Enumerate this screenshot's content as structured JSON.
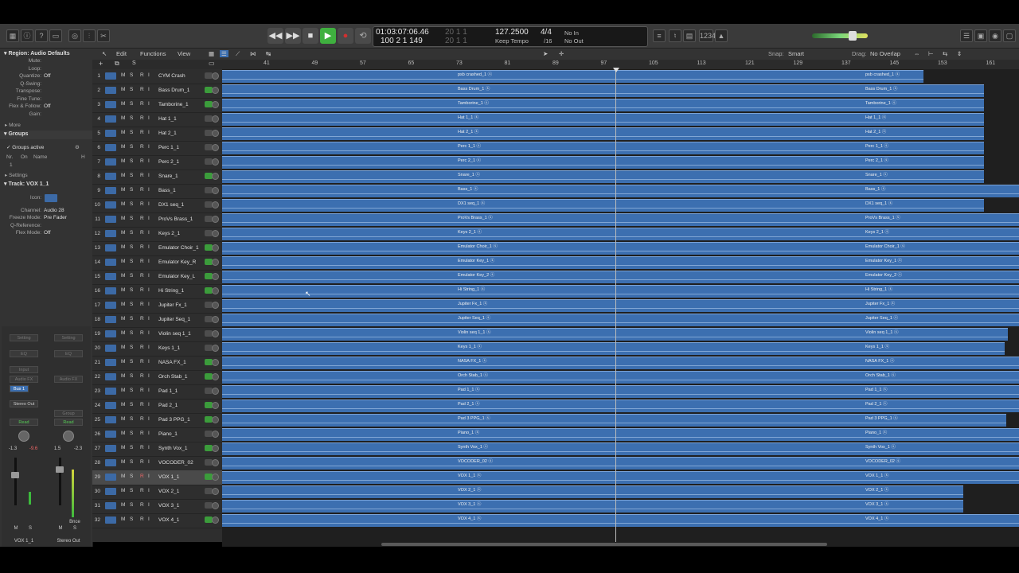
{
  "toolbar": {
    "lcd": {
      "time": "01:03:07:06.46",
      "bars": "100  2  1  149",
      "time_dim": "20  1  1",
      "time_dim2": "20  1  1",
      "tempo": "127.2500",
      "tempo_mode": "Keep Tempo",
      "sig_top": "4/4",
      "sig_bottom": "/16",
      "in": "No In",
      "out": "No Out"
    },
    "counter": "1234"
  },
  "menubar": {
    "edit": "Edit",
    "functions": "Functions",
    "view": "View",
    "snap_label": "Snap:",
    "snap_value": "Smart",
    "drag_label": "Drag:",
    "drag_value": "No Overlap"
  },
  "inspector": {
    "region_header": "Region:",
    "region_name": "Audio Defaults",
    "rows": [
      {
        "label": "Mute:",
        "value": ""
      },
      {
        "label": "Loop:",
        "value": ""
      },
      {
        "label": "Quantize:",
        "value": "Off"
      },
      {
        "label": "Q-Swing:",
        "value": ""
      },
      {
        "label": "Transpose:",
        "value": ""
      },
      {
        "label": "Fine Tune:",
        "value": ""
      },
      {
        "label": "Flex & Follow:",
        "value": "Off"
      },
      {
        "label": "Gain:",
        "value": ""
      }
    ],
    "more": "More",
    "groups_header": "Groups",
    "groups_active": "Groups active",
    "groups_cols": [
      "Nr.",
      "On",
      "Name",
      "H"
    ],
    "group_nr": "1",
    "settings": "Settings",
    "track_header": "Track:",
    "track_name": "VOX 1_1",
    "track_rows": [
      {
        "label": "Icon:",
        "value": ""
      },
      {
        "label": "Channel:",
        "value": "Audio 28"
      },
      {
        "label": "Freeze Mode:",
        "value": "Pre Fader"
      },
      {
        "label": "Q-Reference:",
        "value": ""
      },
      {
        "label": "Flex Mode:",
        "value": "Off"
      }
    ]
  },
  "strips": {
    "left": {
      "setting": "Setting",
      "eq": "EQ",
      "input": "Input",
      "audio_fx": "Audio FX",
      "send": "Bus 1",
      "output": "Stereo Out",
      "auto": "Read",
      "vol1": "-1.3",
      "vol2": "-9.6",
      "mute": "M",
      "solo": "S",
      "name": "VOX 1_1"
    },
    "right": {
      "setting": "Setting",
      "eq": "EQ",
      "audio_fx": "Audio FX",
      "group": "Group",
      "auto": "Read",
      "vol1": "1.5",
      "vol2": "-2.3",
      "mute": "M",
      "solo": "S",
      "bnce": "Bnce",
      "name": "Stereo Out"
    }
  },
  "ruler": [
    "41",
    "49",
    "57",
    "65",
    "73",
    "81",
    "89",
    "97",
    "105",
    "113",
    "121",
    "129",
    "137",
    "145",
    "153",
    "161"
  ],
  "tracks": [
    {
      "n": "1",
      "name": "CYM Crash",
      "region": "psb crashed_1",
      "end": 1160,
      "power": false
    },
    {
      "n": "2",
      "name": "Bass Drum_1",
      "region": "Bass Drum_1",
      "end": 1236,
      "power": true
    },
    {
      "n": "3",
      "name": "Tamborine_1",
      "region": "Tamborine_1",
      "end": 1236,
      "power": true
    },
    {
      "n": "4",
      "name": "Hat 1_1",
      "region": "Hat 1_1",
      "end": 1236,
      "power": false
    },
    {
      "n": "5",
      "name": "Hat 2_1",
      "region": "Hat 2_1",
      "end": 1236,
      "power": false
    },
    {
      "n": "6",
      "name": "Perc 1_1",
      "region": "Perc 1_1",
      "end": 1236,
      "power": false
    },
    {
      "n": "7",
      "name": "Perc 2_1",
      "region": "Perc 2_1",
      "end": 1236,
      "power": false
    },
    {
      "n": "8",
      "name": "Snare_1",
      "region": "Snare_1",
      "end": 1236,
      "power": true
    },
    {
      "n": "9",
      "name": "Bass_1",
      "region": "Bass_1",
      "end": 1280,
      "power": false
    },
    {
      "n": "10",
      "name": "DX1 seq_1",
      "region": "DX1 seq_1",
      "end": 1236,
      "power": false
    },
    {
      "n": "11",
      "name": "ProVs Brass_1",
      "region": "ProVs Brass_1",
      "end": 1280,
      "power": false
    },
    {
      "n": "12",
      "name": "Keys 2_1",
      "region": "Keys 2_1",
      "end": 1280,
      "power": false
    },
    {
      "n": "13",
      "name": "Emulator Choir_1",
      "region": "Emulator Choir_1",
      "end": 1280,
      "power": true
    },
    {
      "n": "14",
      "name": "Emulator Key_R",
      "region": "Emulator Key_1",
      "end": 1280,
      "power": true
    },
    {
      "n": "15",
      "name": "Emulator Key_L",
      "region": "Emulator Key_2",
      "end": 1280,
      "power": true
    },
    {
      "n": "16",
      "name": "Hi String_1",
      "region": "Hi String_1",
      "end": 1280,
      "power": true
    },
    {
      "n": "17",
      "name": "Jupiter Fx_1",
      "region": "Jupiter Fx_1",
      "end": 1280,
      "power": false
    },
    {
      "n": "18",
      "name": "Jupiter Seq_1",
      "region": "Jupiter Seq_1",
      "end": 1280,
      "power": false
    },
    {
      "n": "19",
      "name": "Violin seq 1_1",
      "region": "Violin seq 1_1",
      "end": 1266,
      "power": false
    },
    {
      "n": "20",
      "name": "Keys 1_1",
      "region": "Keys 1_1",
      "end": 1262,
      "power": false
    },
    {
      "n": "21",
      "name": "NASA FX_1",
      "region": "NASA FX_1",
      "end": 1280,
      "power": true
    },
    {
      "n": "22",
      "name": "Orch Stab_1",
      "region": "Orch Stab_1",
      "end": 1280,
      "power": true
    },
    {
      "n": "23",
      "name": "Pad 1_1",
      "region": "Pad 1_1",
      "end": 1280,
      "power": false
    },
    {
      "n": "24",
      "name": "Pad 2_1",
      "region": "Pad 2_1",
      "end": 1280,
      "power": true
    },
    {
      "n": "25",
      "name": "Pad 3 PPG_1",
      "region": "Pad 3 PPG_1",
      "end": 1264,
      "power": true
    },
    {
      "n": "26",
      "name": "Piano_1",
      "region": "Piano_1",
      "end": 1280,
      "power": false
    },
    {
      "n": "27",
      "name": "Synth Vox_1",
      "region": "Synth Vox_1",
      "end": 1280,
      "power": true
    },
    {
      "n": "28",
      "name": "VOCODER_02",
      "region": "VOCODER_02",
      "end": 1280,
      "power": false
    },
    {
      "n": "29",
      "name": "VOX 1_1",
      "region": "VOX 1_1",
      "end": 1280,
      "power": true,
      "selected": true
    },
    {
      "n": "30",
      "name": "VOX 2_1",
      "region": "VOX 2_1",
      "end": 1210,
      "power": false
    },
    {
      "n": "31",
      "name": "VOX 3_1",
      "region": "VOX 3_1",
      "end": 1210,
      "power": false
    },
    {
      "n": "32",
      "name": "VOX 4_1",
      "region": "VOX 4_1",
      "end": 1280,
      "power": true
    }
  ],
  "track_buttons": [
    "M",
    "S",
    "R",
    "I"
  ],
  "colors": {
    "region": "#3c6fb0",
    "accent_green": "#3b9c3b",
    "record": "#d03030",
    "play": "#3fb03f"
  }
}
